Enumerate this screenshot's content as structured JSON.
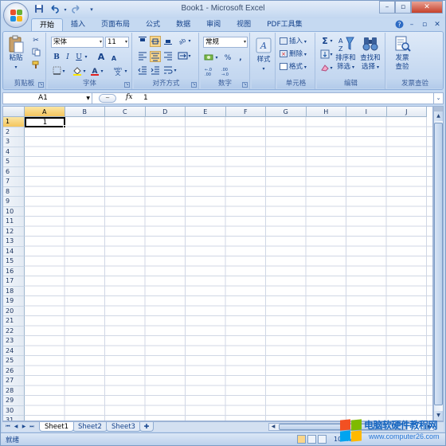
{
  "window": {
    "title": "Book1 - Microsoft Excel",
    "controls": {
      "minimize": "–",
      "restore": "▫",
      "close": "✕"
    }
  },
  "qat": {
    "save_icon": "save-icon",
    "undo_icon": "undo-icon",
    "redo_icon": "redo-icon",
    "customize_icon": "customize-icon"
  },
  "tabs": [
    {
      "label": "开始",
      "active": true
    },
    {
      "label": "插入"
    },
    {
      "label": "页面布局"
    },
    {
      "label": "公式"
    },
    {
      "label": "数据"
    },
    {
      "label": "审阅"
    },
    {
      "label": "视图"
    },
    {
      "label": "PDF工具集"
    }
  ],
  "ribbon": {
    "clipboard": {
      "group_label": "剪贴板",
      "paste": "粘贴"
    },
    "font": {
      "group_label": "字体",
      "font_name": "宋体",
      "font_size": "11",
      "bold": "B",
      "italic": "I",
      "underline": "U",
      "grow": "A",
      "shrink": "A",
      "phonetic": "wén"
    },
    "alignment": {
      "group_label": "对齐方式"
    },
    "number": {
      "group_label": "数字",
      "format": "常规",
      "percent": "%",
      "comma": ","
    },
    "styles": {
      "group_label": "",
      "label": "样式"
    },
    "cells": {
      "group_label": "单元格",
      "insert": "插入",
      "delete": "删除",
      "format": "格式"
    },
    "editing": {
      "group_label": "编辑",
      "sort_filter_1": "排序和",
      "sort_filter_2": "筛选",
      "find_select_1": "查找和",
      "find_select_2": "选择"
    },
    "invoice": {
      "group_label": "发票查验",
      "label_1": "发票",
      "label_2": "查验"
    }
  },
  "formula_bar": {
    "name_box": "A1",
    "fx": "fx",
    "content": "1"
  },
  "grid": {
    "columns": [
      "A",
      "B",
      "C",
      "D",
      "E",
      "F",
      "G",
      "H",
      "I",
      "J"
    ],
    "selected_column": "A",
    "selected_row": "1",
    "rows": [
      "1",
      "2",
      "3",
      "4",
      "5",
      "6",
      "7",
      "8",
      "9",
      "10",
      "11",
      "12",
      "13",
      "14",
      "15",
      "16",
      "17",
      "18",
      "19",
      "20",
      "21",
      "22",
      "23",
      "24",
      "25",
      "26",
      "27",
      "28",
      "29",
      "30",
      "31"
    ],
    "cell_a1": "1"
  },
  "sheets": [
    {
      "label": "Sheet1",
      "active": true
    },
    {
      "label": "Sheet2"
    },
    {
      "label": "Sheet3"
    }
  ],
  "status": {
    "text": "就绪",
    "zoom": "100%"
  },
  "watermark": {
    "title": "电脑软硬件教程网",
    "url": "www.computer26.com"
  },
  "colors": {
    "accent": "#15428b",
    "ribbon_bg": "#dfeaf8",
    "selection": "#f4c55e"
  }
}
